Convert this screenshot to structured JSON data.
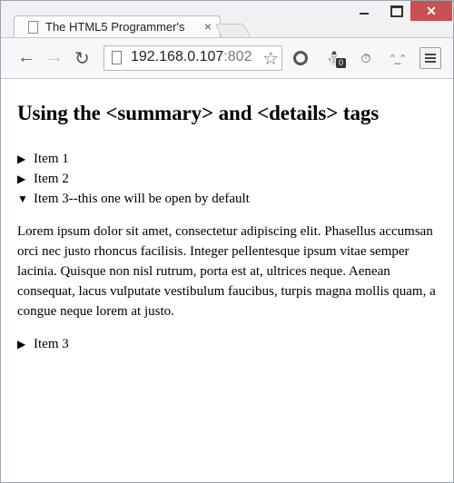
{
  "browser": {
    "tab_title": "The HTML5 Programmer's",
    "tab_close": "×",
    "close_glyph": "✕",
    "url_host": "192.168.0.107",
    "url_port": ":802",
    "ext4_label": "ᵔ_ᵔ",
    "ext2_badge": "0"
  },
  "page": {
    "heading": "Using the <summary> and <details> tags",
    "items": [
      {
        "arrow": "▶",
        "label": "Item 1"
      },
      {
        "arrow": "▶",
        "label": "Item 2"
      },
      {
        "arrow": "▼",
        "label": "Item 3--this one will be open by default"
      }
    ],
    "paragraph": "Lorem ipsum dolor sit amet, consectetur adipiscing elit. Phasellus accumsan orci nec justo rhoncus facilisis. Integer pellentesque ipsum vitae semper lacinia. Quisque non nisl rutrum, porta est at, ultrices neque. Aenean consequat, lacus vulputate vestibulum faucibus, turpis magna mollis quam, a congue neque lorem at justo.",
    "last_item": {
      "arrow": "▶",
      "label": "Item 3"
    }
  }
}
